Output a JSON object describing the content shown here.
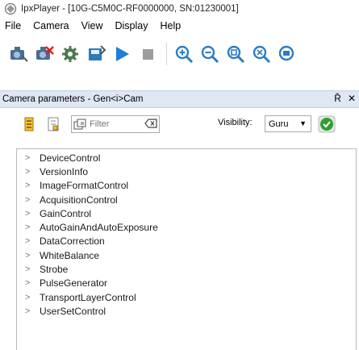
{
  "window": {
    "title": "IpxPlayer - [10G-C5M0C-RF0000000, SN:01230001]"
  },
  "menu": [
    "File",
    "Camera",
    "View",
    "Display",
    "Help"
  ],
  "toolbar": {
    "buttons": [
      "camera-settings-icon",
      "camera-disconnect-icon",
      "gear-icon",
      "save-icon",
      "play-icon",
      "stop-icon"
    ],
    "zoom_buttons": [
      "zoom-in-icon",
      "zoom-out-icon",
      "zoom-fit-icon",
      "zoom-actual-icon",
      "zoom-extra-icon"
    ]
  },
  "panel": {
    "title": "Camera parameters - Gen<i>Cam",
    "pin_glyph": "Ř",
    "close_glyph": "✕",
    "filter_placeholder": "Filter",
    "visibility_label": "Visibility:",
    "visibility_value": "Guru"
  },
  "tree": {
    "items": [
      "DeviceControl",
      "VersionInfo",
      "ImageFormatControl",
      "AcquisitionControl",
      "GainControl",
      "AutoGainAndAutoExposure",
      "DataCorrection",
      "WhiteBalance",
      "Strobe",
      "PulseGenerator",
      "TransportLayerControl",
      "UserSetControl"
    ]
  }
}
